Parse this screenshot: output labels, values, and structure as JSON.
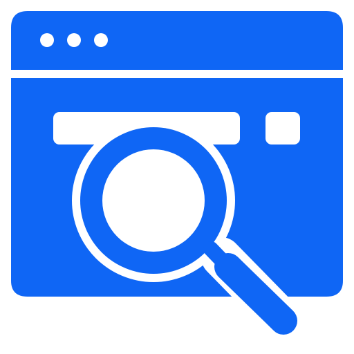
{
  "icon": {
    "name": "browser-search-icon",
    "colors": {
      "primary": "#0f66f5",
      "background": "#ffffff"
    },
    "window": {
      "title_bar_dots": [
        "dot-1",
        "dot-2",
        "dot-3"
      ]
    }
  }
}
